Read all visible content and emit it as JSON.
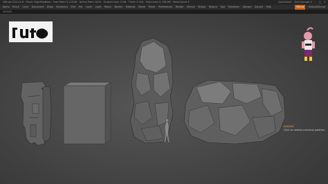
{
  "window": {
    "title": "ZBrush 2021.6.6 · Mesh: HighPolyBase · Free Mem 3.125GB · Active Mem 1833 · Scratch Disk 1196 · Timer 0.016 · PolyCount 0.758 MP · MeshCount 4",
    "quicksave": "QuickSave",
    "see_through": "See-through 0",
    "menus_label": "Menus",
    "default_zscript": "DefaultZScript"
  },
  "menus": [
    "Alpha",
    "Brush",
    "Color",
    "Document",
    "Draw",
    "Dynamics",
    "Edit",
    "File",
    "Layer",
    "Light",
    "Macro",
    "Marker",
    "Material",
    "Movie",
    "Picker",
    "Preferences",
    "Render",
    "Stencil",
    "Stroke",
    "Texture",
    "Tool",
    "Transform",
    "Zplugin",
    "Zscript",
    "Help"
  ],
  "statusline": "DIVIDER",
  "tooltip": {
    "title": "DIVIDER",
    "description": "Click to restore previous position."
  },
  "colors": {
    "accent": "#c8641e",
    "tooltip_title": "#e0a552",
    "canvas": "#4a4a4a"
  }
}
